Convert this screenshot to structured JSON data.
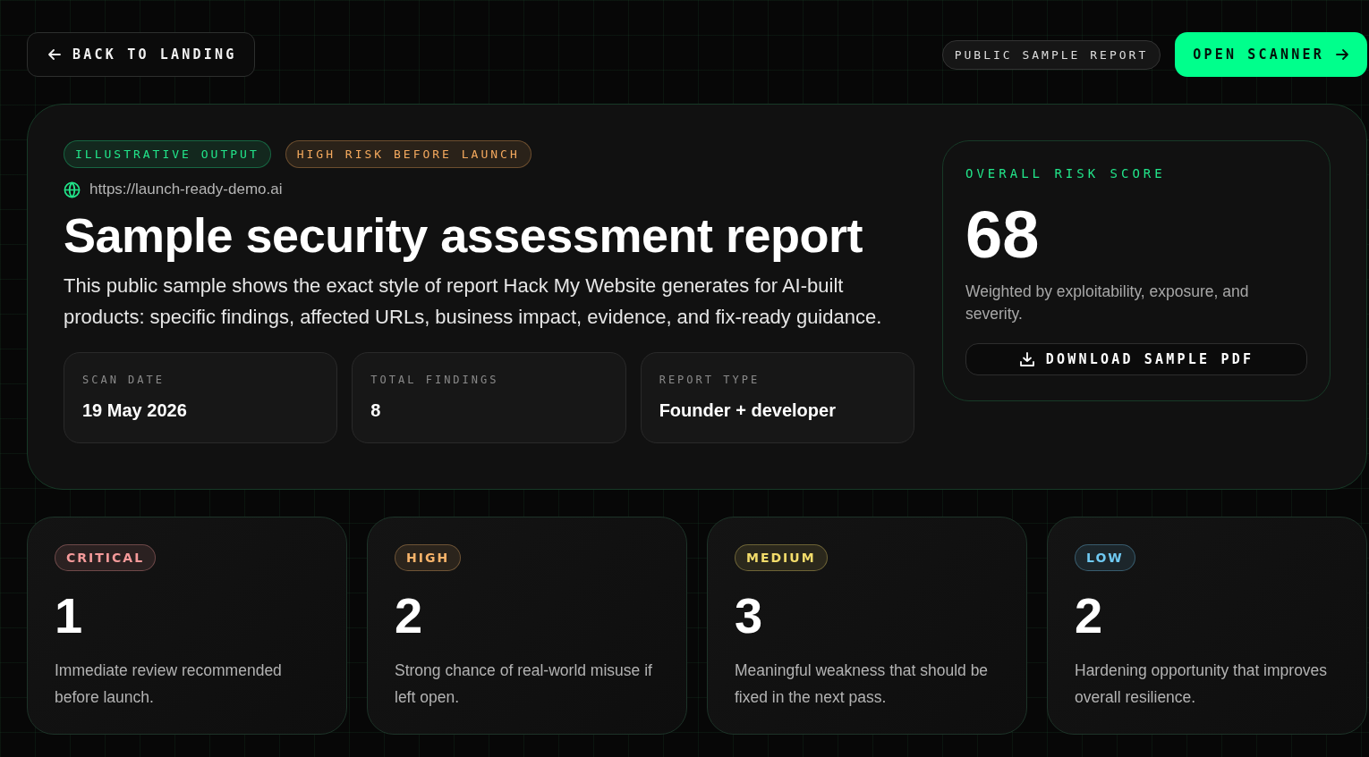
{
  "header": {
    "back_button": "BACK TO LANDING",
    "badge": "PUBLIC SAMPLE REPORT",
    "primary_button": "OPEN SCANNER"
  },
  "report": {
    "tags": [
      {
        "label": "ILLUSTRATIVE OUTPUT",
        "color": "#22e58a"
      },
      {
        "label": "HIGH RISK BEFORE LAUNCH",
        "color": "#f4a95e"
      }
    ],
    "url": "https://launch-ready-demo.ai",
    "title": "Sample security assessment report",
    "description": "This public sample shows the exact style of report Hack My Website generates for AI-built products: specific findings, affected URLs, business impact, evidence, and fix-ready guidance.",
    "stats": [
      {
        "label": "SCAN DATE",
        "value": "19 May 2026"
      },
      {
        "label": "TOTAL FINDINGS",
        "value": "8"
      },
      {
        "label": "REPORT TYPE",
        "value": "Founder + developer"
      }
    ],
    "risk_score": {
      "label": "OVERALL RISK SCORE",
      "score": "68",
      "note": "Weighted by exploitability, exposure, and severity.",
      "download_button": "DOWNLOAD SAMPLE PDF"
    }
  },
  "severities": [
    {
      "label": "CRITICAL",
      "color": "#f59a9a",
      "count": "1",
      "description": "Immediate review recommended before launch."
    },
    {
      "label": "HIGH",
      "color": "#f7b36a",
      "count": "2",
      "description": "Strong chance of real-world misuse if left open."
    },
    {
      "label": "MEDIUM",
      "color": "#f3dc6a",
      "count": "3",
      "description": "Meaningful weakness that should be fixed in the next pass."
    },
    {
      "label": "LOW",
      "color": "#6fc9f2",
      "count": "2",
      "description": "Hardening opportunity that improves overall resilience."
    }
  ]
}
